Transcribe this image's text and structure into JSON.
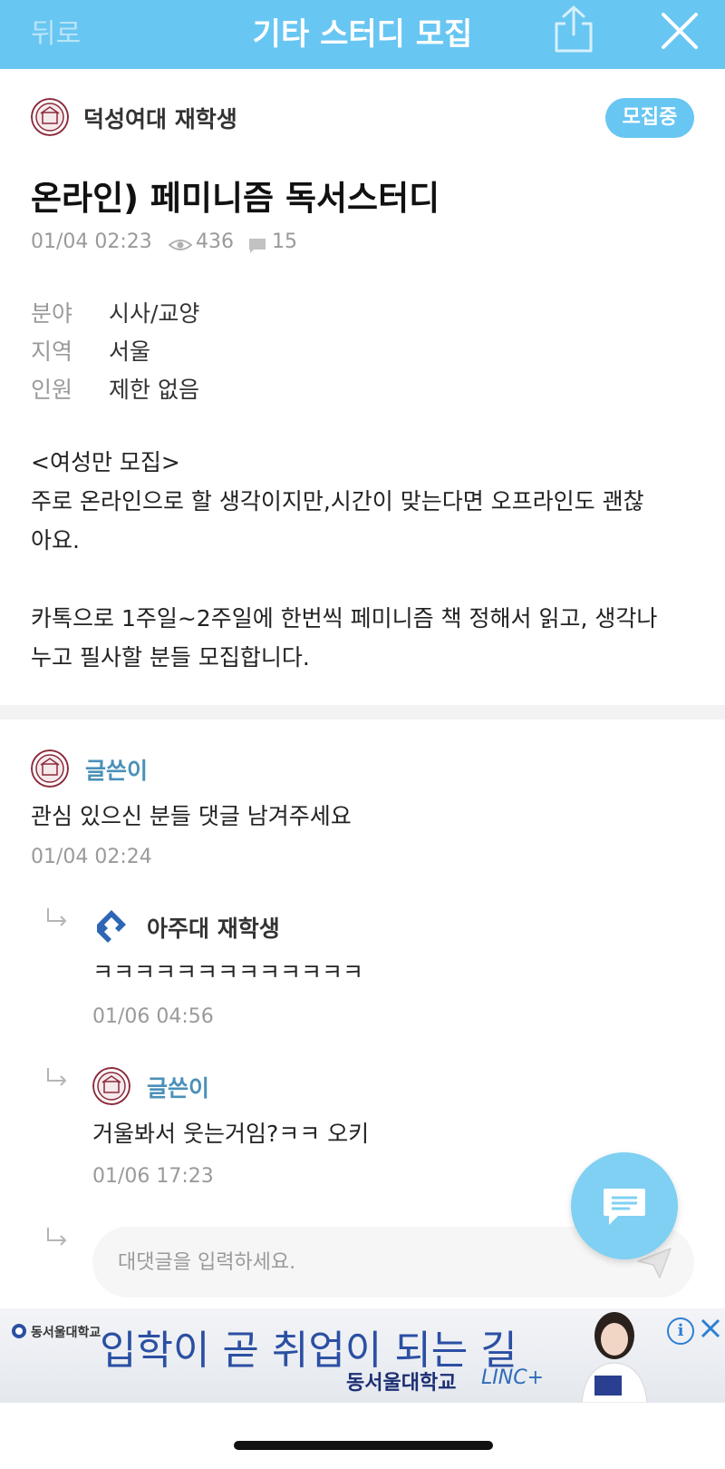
{
  "header": {
    "back_label": "뒤로",
    "title": "기타 스터디 모집",
    "share_icon": "share-icon",
    "close_icon": "close-icon"
  },
  "post": {
    "author": "덕성여대 재학생",
    "status_badge": "모집중",
    "title": "온라인) 페미니즘 독서스터디",
    "date": "01/04 02:23",
    "views": "436",
    "comments": "15",
    "info": [
      {
        "label": "분야",
        "value": "시사/교양"
      },
      {
        "label": "지역",
        "value": "서울"
      },
      {
        "label": "인원",
        "value": "제한 없음"
      }
    ],
    "body_lines": [
      "<여성만 모집>",
      "주로 온라인으로 할 생각이지만,시간이 맞는다면 오프라인도 괜찮",
      "아요.",
      "카톡으로 1주일~2주일에 한번씩 페미니즘 책 정해서 읽고, 생각나",
      "누고 필사할 분들 모집합니다."
    ]
  },
  "comments": [
    {
      "author": "글쓴이",
      "text": "관심 있으신 분들 댓글 남겨주세요",
      "time": "01/04 02:24"
    },
    {
      "author": "아주대 재학생",
      "text": "ㅋㅋㅋㅋㅋㅋㅋㅋㅋㅋㅋㅋㅋ",
      "time": "01/06 04:56"
    },
    {
      "author": "글쓴이",
      "text": "거울봐서 웃는거임?ㅋㅋ 오키",
      "time": "01/06 17:23"
    }
  ],
  "reply_input": {
    "placeholder": "대댓글을 입력하세요."
  },
  "ad": {
    "logo_text": "동서울대학교",
    "headline": "입학이 곧 취업이 되는 길",
    "sub": "동서울대학교",
    "brand": "LINC+",
    "info_glyph": "i"
  },
  "colors": {
    "accent": "#68c6f2",
    "author_comment": "#4a90b8",
    "muted": "#9a9a9a"
  }
}
